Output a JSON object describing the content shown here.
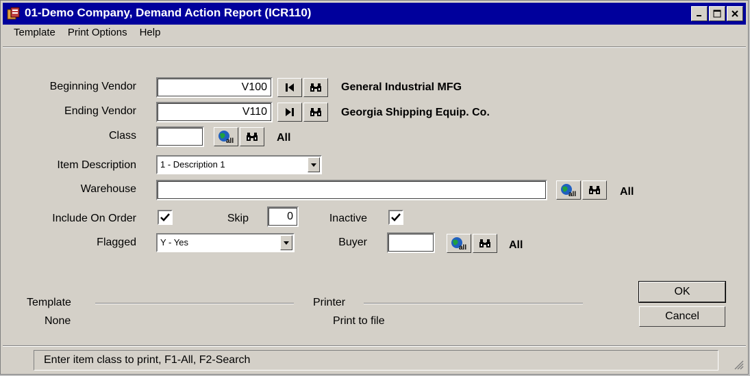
{
  "window": {
    "title": "01-Demo Company, Demand Action Report (ICR110)"
  },
  "menu": [
    {
      "label": "Template"
    },
    {
      "label": "Print Options"
    },
    {
      "label": "Help"
    }
  ],
  "form": {
    "beginning_vendor": {
      "label": "Beginning Vendor",
      "value": "V100",
      "description": "General Industrial MFG"
    },
    "ending_vendor": {
      "label": "Ending Vendor",
      "value": "V110",
      "description": "Georgia Shipping Equip. Co."
    },
    "class": {
      "label": "Class",
      "value": "",
      "description": "All"
    },
    "item_description": {
      "label": "Item Description",
      "selected": "1 - Description 1"
    },
    "warehouse": {
      "label": "Warehouse",
      "value": "",
      "description": "All"
    },
    "include_on_order": {
      "label": "Include On Order",
      "checked": true
    },
    "skip": {
      "label": "Skip",
      "value": "0"
    },
    "inactive": {
      "label": "Inactive",
      "checked": true
    },
    "flagged": {
      "label": "Flagged",
      "selected": "Y - Yes"
    },
    "buyer": {
      "label": "Buyer",
      "value": "",
      "description": "All"
    }
  },
  "template_group": {
    "label": "Template",
    "value": "None"
  },
  "printer_group": {
    "label": "Printer",
    "value": "Print to file"
  },
  "buttons": {
    "ok": "OK",
    "cancel": "Cancel"
  },
  "status": {
    "message": "Enter item class to print, F1-All, F2-Search"
  },
  "icons": [
    "app-icon",
    "first-record-icon",
    "last-record-icon",
    "binoculars-icon",
    "globe-all-icon",
    "dropdown-arrow-icon",
    "check-icon"
  ]
}
